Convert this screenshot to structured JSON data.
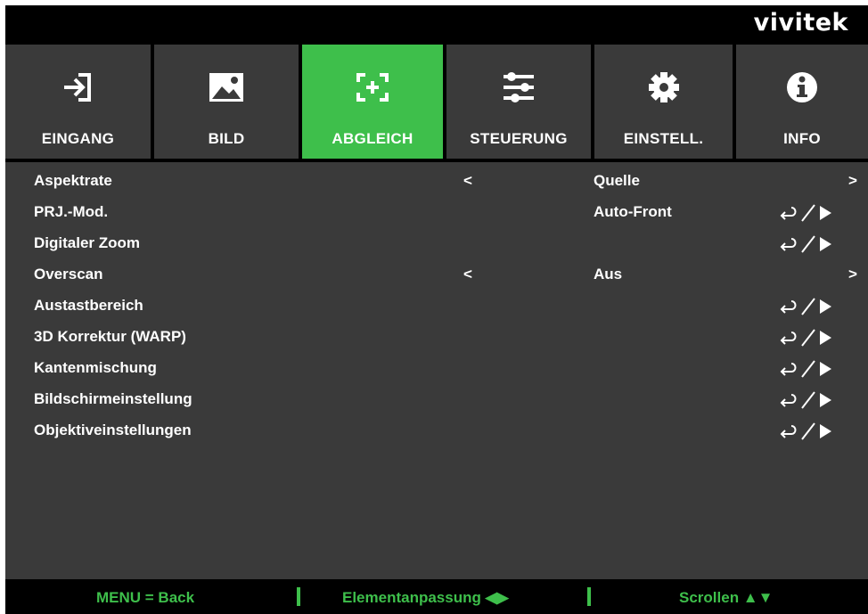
{
  "brand": "vivitek",
  "tabs": [
    {
      "label": "EINGANG",
      "icon": "input-icon",
      "active": false
    },
    {
      "label": "BILD",
      "icon": "image-icon",
      "active": false
    },
    {
      "label": "ABGLEICH",
      "icon": "alignment-icon",
      "active": true
    },
    {
      "label": "STEUERUNG",
      "icon": "sliders-icon",
      "active": false
    },
    {
      "label": "EINSTELL.",
      "icon": "gear-icon",
      "active": false
    },
    {
      "label": "INFO",
      "icon": "info-icon",
      "active": false
    }
  ],
  "menu": {
    "items": [
      {
        "label": "Aspektrate",
        "left": "<",
        "value": "Quelle",
        "right": ">"
      },
      {
        "label": "PRJ.-Mod.",
        "value": "Auto-Front",
        "enter": true
      },
      {
        "label": "Digitaler Zoom",
        "enter": true
      },
      {
        "label": "Overscan",
        "left": "<",
        "value": "Aus",
        "right": ">"
      },
      {
        "label": "Austastbereich",
        "enter": true
      },
      {
        "label": "3D Korrektur (WARP)",
        "enter": true
      },
      {
        "label": "Kantenmischung",
        "enter": true
      },
      {
        "label": "Bildschirmeinstellung",
        "enter": true
      },
      {
        "label": "Objektiveinstellungen",
        "enter": true
      }
    ]
  },
  "footer": {
    "back": "MENU = Back",
    "adjust": "Elementanpassung ◀▶",
    "scroll": "Scrollen ▲▼"
  },
  "colors": {
    "accent": "#3ebf4b",
    "tab_bg": "#3a3a3a",
    "menu_bg": "#3a3a3a",
    "frame": "#000000"
  }
}
